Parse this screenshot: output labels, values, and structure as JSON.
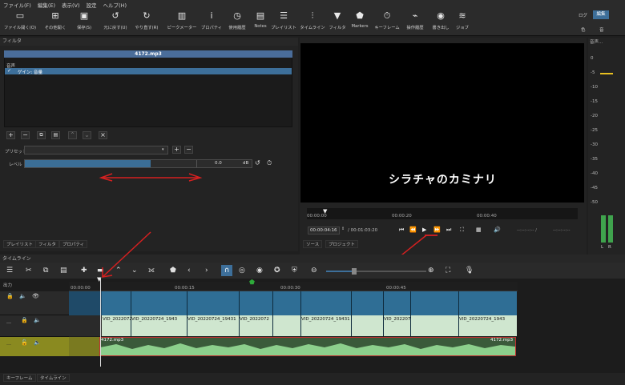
{
  "menu": [
    "ファイル(F)",
    "編集(E)",
    "表示(V)",
    "設定",
    "ヘルプ(H)"
  ],
  "toolbar": [
    {
      "label": "ファイル開く(O)",
      "icon": "folder-icon"
    },
    {
      "label": "その他開く",
      "icon": "open-other-icon"
    },
    {
      "label": "保存(S)",
      "icon": "save-icon"
    },
    {
      "label": "元に戻す(U)",
      "icon": "undo-icon"
    },
    {
      "label": "やり直す(R)",
      "icon": "redo-icon"
    },
    {
      "label": "ピークメーター",
      "icon": "peak-meter-icon"
    },
    {
      "label": "プロパティ",
      "icon": "info-icon"
    },
    {
      "label": "使用履歴",
      "icon": "history-icon"
    },
    {
      "label": "Notes",
      "icon": "notes-icon"
    },
    {
      "label": "プレイリスト",
      "icon": "playlist-icon"
    },
    {
      "label": "タイムライン",
      "icon": "timeline-icon"
    },
    {
      "label": "フィルタ",
      "icon": "filter-icon"
    },
    {
      "label": "Markers",
      "icon": "marker-icon"
    },
    {
      "label": "キーフレーム",
      "icon": "stopwatch-icon"
    },
    {
      "label": "操作履歴",
      "icon": "job-history-icon"
    },
    {
      "label": "書き出し",
      "icon": "export-icon"
    },
    {
      "label": "ジョブ",
      "icon": "jobs-icon"
    }
  ],
  "layout_modes": [
    "ログ",
    "編集",
    "色",
    "音"
  ],
  "filters": {
    "header": "フィルタ",
    "clip_name": "4172.mp3",
    "category": "音声",
    "items": [
      {
        "label": "ゲイン: 音量",
        "checked": true
      }
    ],
    "preset_label": "プリセット",
    "level_label": "レベル",
    "level_value": "0.0",
    "level_unit": "dB",
    "level_fill": 0.55
  },
  "left_tabs": [
    "プレイリスト",
    "フィルタ",
    "プロパティ"
  ],
  "player": {
    "subtitle": "シラチャのカミナリ",
    "ruler": [
      "00:00:00",
      "00:00:20",
      "00:00:40"
    ],
    "current": "00:00:04:16",
    "total": "/ 00:01:03:20",
    "in_point": "--:--:--:-- /",
    "out_point": "--:--:--:--",
    "tabs": [
      "ソース",
      "プロジェクト"
    ]
  },
  "meter": {
    "header": "音声...",
    "scale": [
      "0",
      "-5",
      "-10",
      "-15",
      "-20",
      "-25",
      "-30",
      "-35",
      "-40",
      "-45",
      "-50"
    ],
    "channels": [
      "L",
      "R"
    ]
  },
  "timeline": {
    "header": "タイムライン",
    "output_label": "出力",
    "ruler": [
      "00:00:00",
      "00:00:15",
      "00:00:30",
      "00:00:45"
    ],
    "clips_v2": [
      "VID_2022072",
      "VID_20220724_1943",
      "VID_20220724_19431",
      "VID_2022072",
      "VID_20220724_19431",
      "VID_20220724_1943",
      "VID_20220724_1943"
    ],
    "audio_clip": "4172.mp3"
  },
  "bottom_tabs": [
    "キーフレーム",
    "タイムライン"
  ],
  "colors": {
    "accent": "#3b6e96",
    "selection": "#3d6f9a",
    "audio_track": "#8a8a20",
    "red_annotation": "#d62020"
  }
}
